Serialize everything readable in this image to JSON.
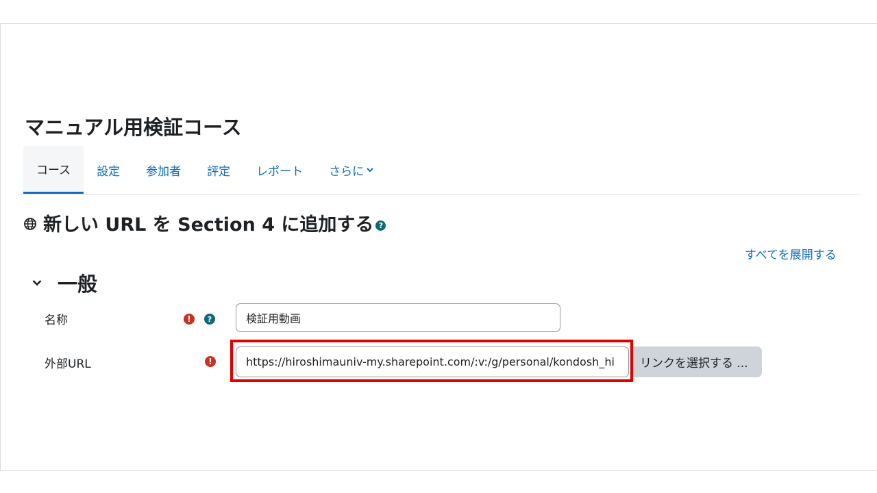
{
  "course": {
    "title": "マニュアル用検証コース"
  },
  "nav": {
    "items": [
      {
        "label": "コース",
        "active": true
      },
      {
        "label": "設定"
      },
      {
        "label": "参加者"
      },
      {
        "label": "評定"
      },
      {
        "label": "レポート"
      },
      {
        "label": "さらに",
        "has_dropdown": true
      }
    ]
  },
  "page": {
    "heading": "新しい URL を Section 4 に追加する",
    "expand_all": "すべてを展開する"
  },
  "section": {
    "title": "一般"
  },
  "form": {
    "name": {
      "label": "名称",
      "value": "検証用動画"
    },
    "url": {
      "label": "外部URL",
      "value": "https://hiroshimauniv-my.sharepoint.com/:v:/g/personal/kondosh_hi",
      "choose_button": "リンクを選択する ..."
    }
  },
  "colors": {
    "accent": "#0f6cbf",
    "required": "#ca3120",
    "help": "#0f6974",
    "highlight": "#e00000"
  }
}
